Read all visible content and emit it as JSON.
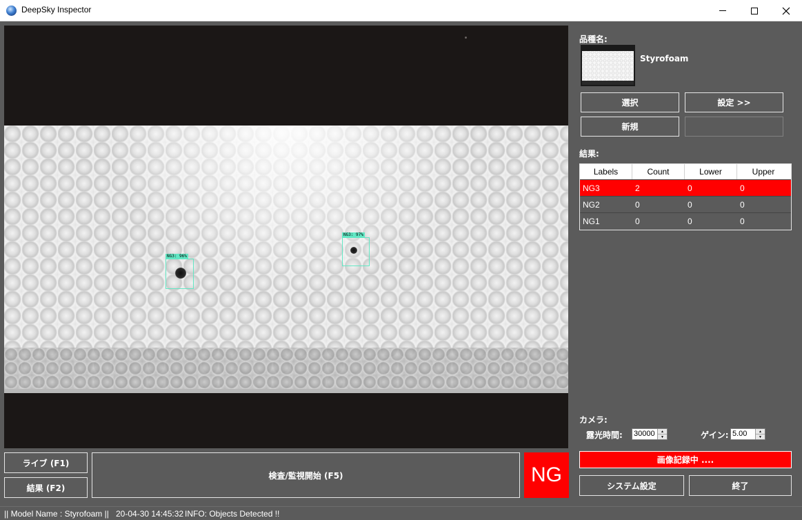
{
  "window": {
    "title": "DeepSky Inspector",
    "controls": {
      "minimize_icon": "minimize-icon",
      "maximize_icon": "maximize-icon",
      "close_icon": "close-icon"
    }
  },
  "camera_view": {
    "detections": [
      {
        "label": "NG3: 96%"
      },
      {
        "label": "NG3: 97%"
      }
    ]
  },
  "left_controls": {
    "live_label": "ライブ (F1)",
    "result_label": "結果 (F2)",
    "start_label": "検査/監視開始 (F5)",
    "verdict": "NG",
    "verdict_color": "#ff0000"
  },
  "product": {
    "heading": "品種名:",
    "name": "Styrofoam",
    "select_label": "選択",
    "settings_label": "設定 >>",
    "new_label": "新規"
  },
  "results": {
    "heading": "結果:",
    "columns": [
      "Labels",
      "Count",
      "Lower",
      "Upper"
    ],
    "rows": [
      {
        "label": "NG3",
        "count": "2",
        "lower": "0",
        "upper": "0",
        "highlight": true
      },
      {
        "label": "NG2",
        "count": "0",
        "lower": "0",
        "upper": "0",
        "highlight": false
      },
      {
        "label": "NG1",
        "count": "0",
        "lower": "0",
        "upper": "0",
        "highlight": false
      }
    ]
  },
  "camera": {
    "heading": "カメラ:",
    "exposure_label": "露光時間:",
    "exposure_value": "30000",
    "gain_label": "ゲイン:",
    "gain_value": "5.00"
  },
  "recording_status": "画像記録中 ....",
  "bottom_right": {
    "system_label": "システム設定",
    "exit_label": "終了"
  },
  "statusbar": {
    "model": "|| Model Name : Styrofoam ||",
    "timestamp": "20-04-30 14:45:32",
    "info": "INFO:   Objects Detected !!"
  },
  "colors": {
    "panel_bg": "#5b5b5b",
    "ng_red": "#ff0000",
    "detection_box": "#62e7c4"
  }
}
